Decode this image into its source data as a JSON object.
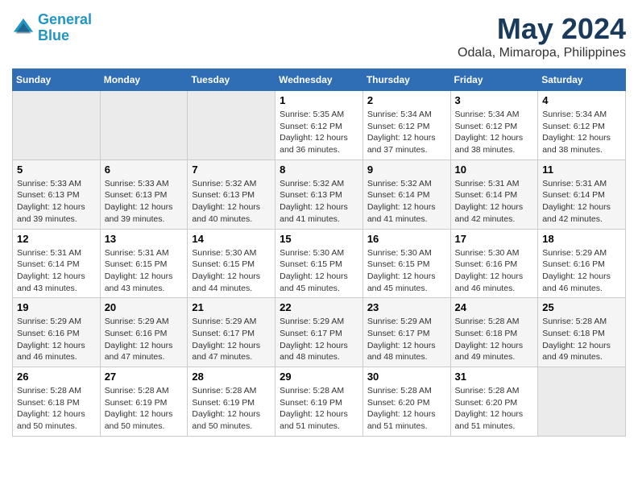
{
  "header": {
    "logo_line1": "General",
    "logo_line2": "Blue",
    "title": "May 2024",
    "subtitle": "Odala, Mimaropa, Philippines"
  },
  "days_of_week": [
    "Sunday",
    "Monday",
    "Tuesday",
    "Wednesday",
    "Thursday",
    "Friday",
    "Saturday"
  ],
  "weeks": [
    {
      "days": [
        {
          "num": "",
          "info": "",
          "empty": true
        },
        {
          "num": "",
          "info": "",
          "empty": true
        },
        {
          "num": "",
          "info": "",
          "empty": true
        },
        {
          "num": "1",
          "info": "Sunrise: 5:35 AM\nSunset: 6:12 PM\nDaylight: 12 hours\nand 36 minutes."
        },
        {
          "num": "2",
          "info": "Sunrise: 5:34 AM\nSunset: 6:12 PM\nDaylight: 12 hours\nand 37 minutes."
        },
        {
          "num": "3",
          "info": "Sunrise: 5:34 AM\nSunset: 6:12 PM\nDaylight: 12 hours\nand 38 minutes."
        },
        {
          "num": "4",
          "info": "Sunrise: 5:34 AM\nSunset: 6:12 PM\nDaylight: 12 hours\nand 38 minutes."
        }
      ]
    },
    {
      "days": [
        {
          "num": "5",
          "info": "Sunrise: 5:33 AM\nSunset: 6:13 PM\nDaylight: 12 hours\nand 39 minutes."
        },
        {
          "num": "6",
          "info": "Sunrise: 5:33 AM\nSunset: 6:13 PM\nDaylight: 12 hours\nand 39 minutes."
        },
        {
          "num": "7",
          "info": "Sunrise: 5:32 AM\nSunset: 6:13 PM\nDaylight: 12 hours\nand 40 minutes."
        },
        {
          "num": "8",
          "info": "Sunrise: 5:32 AM\nSunset: 6:13 PM\nDaylight: 12 hours\nand 41 minutes."
        },
        {
          "num": "9",
          "info": "Sunrise: 5:32 AM\nSunset: 6:14 PM\nDaylight: 12 hours\nand 41 minutes."
        },
        {
          "num": "10",
          "info": "Sunrise: 5:31 AM\nSunset: 6:14 PM\nDaylight: 12 hours\nand 42 minutes."
        },
        {
          "num": "11",
          "info": "Sunrise: 5:31 AM\nSunset: 6:14 PM\nDaylight: 12 hours\nand 42 minutes."
        }
      ]
    },
    {
      "days": [
        {
          "num": "12",
          "info": "Sunrise: 5:31 AM\nSunset: 6:14 PM\nDaylight: 12 hours\nand 43 minutes."
        },
        {
          "num": "13",
          "info": "Sunrise: 5:31 AM\nSunset: 6:15 PM\nDaylight: 12 hours\nand 43 minutes."
        },
        {
          "num": "14",
          "info": "Sunrise: 5:30 AM\nSunset: 6:15 PM\nDaylight: 12 hours\nand 44 minutes."
        },
        {
          "num": "15",
          "info": "Sunrise: 5:30 AM\nSunset: 6:15 PM\nDaylight: 12 hours\nand 45 minutes."
        },
        {
          "num": "16",
          "info": "Sunrise: 5:30 AM\nSunset: 6:15 PM\nDaylight: 12 hours\nand 45 minutes."
        },
        {
          "num": "17",
          "info": "Sunrise: 5:30 AM\nSunset: 6:16 PM\nDaylight: 12 hours\nand 46 minutes."
        },
        {
          "num": "18",
          "info": "Sunrise: 5:29 AM\nSunset: 6:16 PM\nDaylight: 12 hours\nand 46 minutes."
        }
      ]
    },
    {
      "days": [
        {
          "num": "19",
          "info": "Sunrise: 5:29 AM\nSunset: 6:16 PM\nDaylight: 12 hours\nand 46 minutes."
        },
        {
          "num": "20",
          "info": "Sunrise: 5:29 AM\nSunset: 6:16 PM\nDaylight: 12 hours\nand 47 minutes."
        },
        {
          "num": "21",
          "info": "Sunrise: 5:29 AM\nSunset: 6:17 PM\nDaylight: 12 hours\nand 47 minutes."
        },
        {
          "num": "22",
          "info": "Sunrise: 5:29 AM\nSunset: 6:17 PM\nDaylight: 12 hours\nand 48 minutes."
        },
        {
          "num": "23",
          "info": "Sunrise: 5:29 AM\nSunset: 6:17 PM\nDaylight: 12 hours\nand 48 minutes."
        },
        {
          "num": "24",
          "info": "Sunrise: 5:28 AM\nSunset: 6:18 PM\nDaylight: 12 hours\nand 49 minutes."
        },
        {
          "num": "25",
          "info": "Sunrise: 5:28 AM\nSunset: 6:18 PM\nDaylight: 12 hours\nand 49 minutes."
        }
      ]
    },
    {
      "days": [
        {
          "num": "26",
          "info": "Sunrise: 5:28 AM\nSunset: 6:18 PM\nDaylight: 12 hours\nand 50 minutes."
        },
        {
          "num": "27",
          "info": "Sunrise: 5:28 AM\nSunset: 6:19 PM\nDaylight: 12 hours\nand 50 minutes."
        },
        {
          "num": "28",
          "info": "Sunrise: 5:28 AM\nSunset: 6:19 PM\nDaylight: 12 hours\nand 50 minutes."
        },
        {
          "num": "29",
          "info": "Sunrise: 5:28 AM\nSunset: 6:19 PM\nDaylight: 12 hours\nand 51 minutes."
        },
        {
          "num": "30",
          "info": "Sunrise: 5:28 AM\nSunset: 6:20 PM\nDaylight: 12 hours\nand 51 minutes."
        },
        {
          "num": "31",
          "info": "Sunrise: 5:28 AM\nSunset: 6:20 PM\nDaylight: 12 hours\nand 51 minutes."
        },
        {
          "num": "",
          "info": "",
          "empty": true
        }
      ]
    }
  ]
}
